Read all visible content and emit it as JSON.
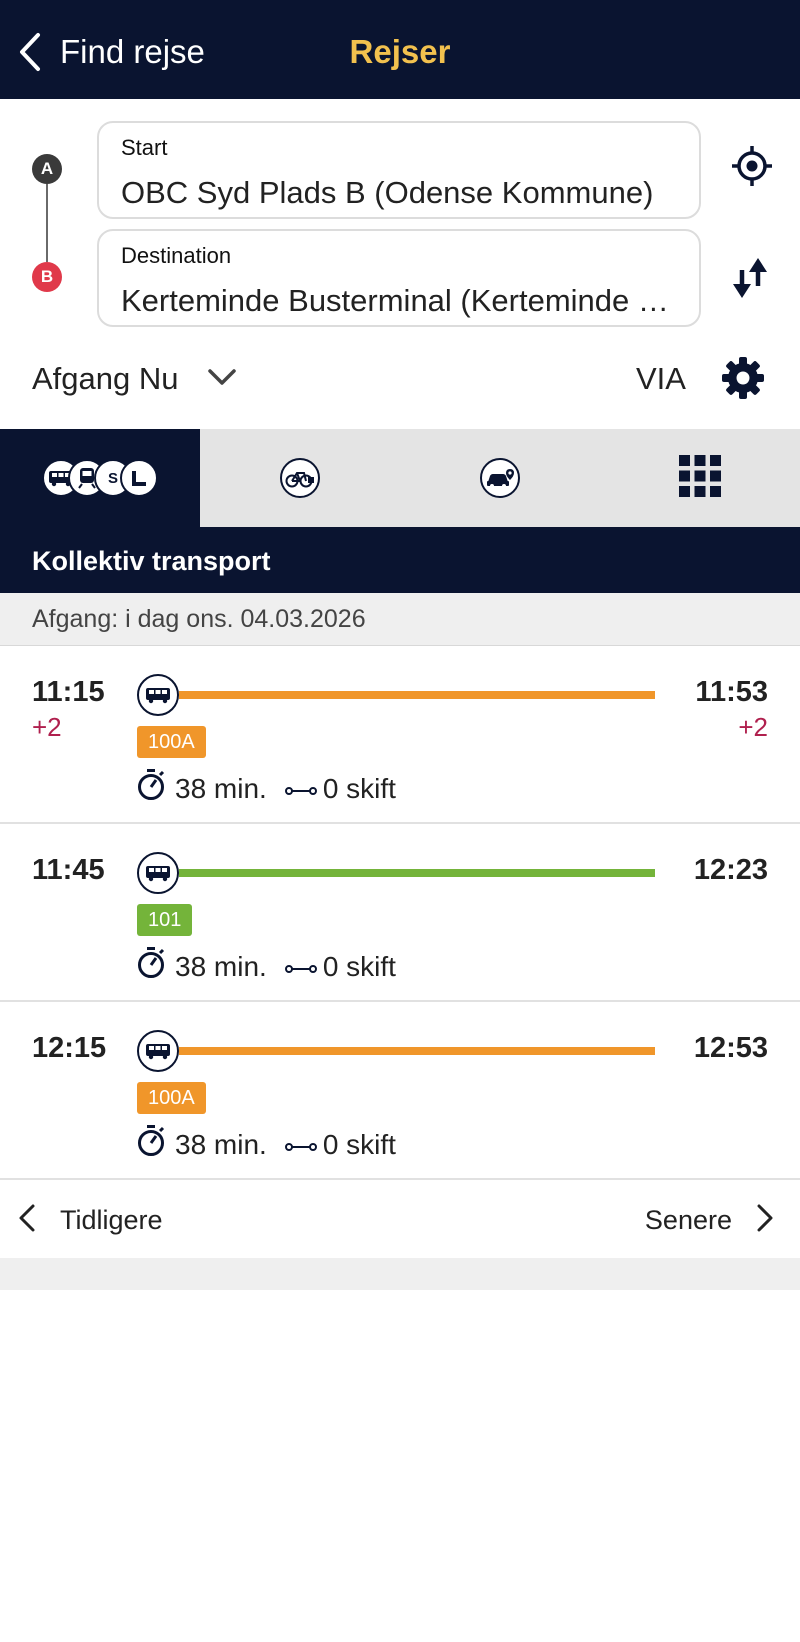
{
  "colors": {
    "navy": "#0a1430",
    "title_yellow": "#f2c14e",
    "line_orange": "#f0962a",
    "line_green": "#74b43a",
    "delay_red": "#b0204e",
    "dest_marker_red": "#e0394a"
  },
  "header": {
    "back_label": "Find rejse",
    "title": "Rejser"
  },
  "search": {
    "start_marker": "A",
    "start_label": "Start",
    "start_value": "OBC Syd Plads B (Odense Kommune)",
    "dest_marker": "B",
    "dest_label": "Destination",
    "dest_value": "Kerteminde Busterminal (Kerteminde Kommune)",
    "locate_icon": "crosshair-icon",
    "swap_icon": "swap-vertical-icon"
  },
  "options": {
    "departure_label": "Afgang Nu",
    "via_label": "VIA",
    "settings_icon": "gear-icon"
  },
  "mode_tabs": [
    {
      "name": "public-transport",
      "icons": [
        "bus-icon",
        "train-icon",
        "s-train-icon",
        "metro-icon"
      ],
      "badge_text": "S",
      "active": true
    },
    {
      "name": "bike",
      "icons": [
        "bicycle-icon"
      ],
      "active": false
    },
    {
      "name": "car",
      "icons": [
        "car-location-icon"
      ],
      "active": false
    },
    {
      "name": "more",
      "icons": [
        "grid-icon"
      ],
      "active": false
    }
  ],
  "section_title": "Kollektiv transport",
  "date_label": "Afgang: i dag ons. 04.03.2026",
  "trips": [
    {
      "dep": "11:15",
      "dep_delay": "+2",
      "arr": "11:53",
      "arr_delay": "+2",
      "line": "100A",
      "line_color": "#f0962a",
      "duration": "38 min.",
      "changes": "0 skift"
    },
    {
      "dep": "11:45",
      "dep_delay": "",
      "arr": "12:23",
      "arr_delay": "",
      "line": "101",
      "line_color": "#74b43a",
      "duration": "38 min.",
      "changes": "0 skift"
    },
    {
      "dep": "12:15",
      "dep_delay": "",
      "arr": "12:53",
      "arr_delay": "",
      "line": "100A",
      "line_color": "#f0962a",
      "duration": "38 min.",
      "changes": "0 skift"
    }
  ],
  "pager": {
    "prev_label": "Tidligere",
    "next_label": "Senere"
  }
}
